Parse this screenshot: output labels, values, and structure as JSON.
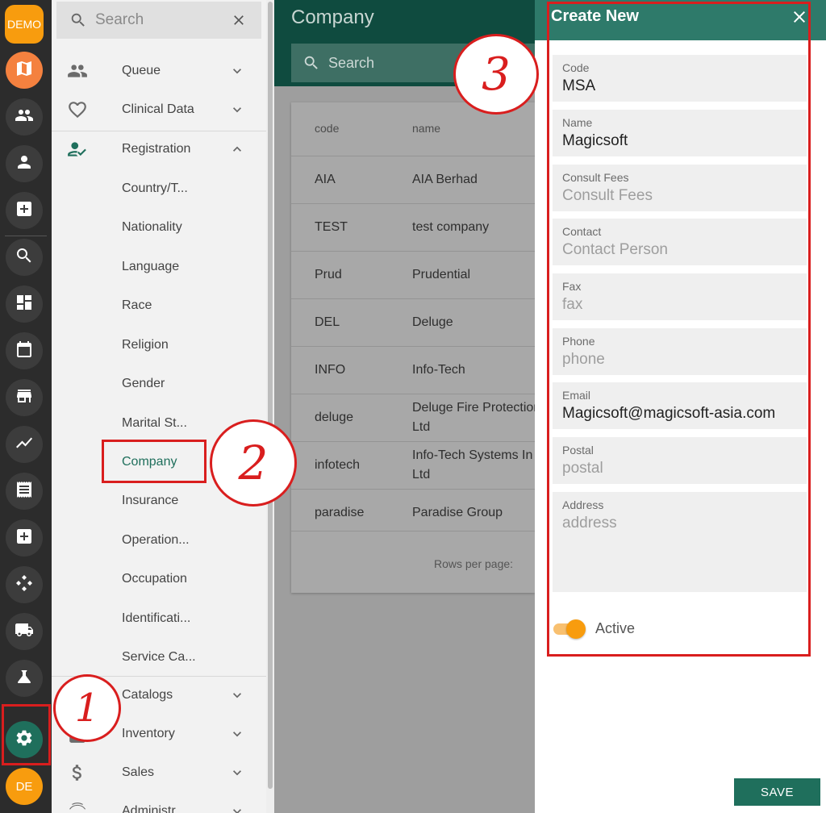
{
  "rail": {
    "demo_label": "DEMO",
    "avatar_label": "DE",
    "items": [
      {
        "icon": "map-icon"
      },
      {
        "icon": "people-icon"
      },
      {
        "icon": "person-icon"
      },
      {
        "icon": "medical-plus-icon"
      },
      {
        "icon": "search-icon"
      },
      {
        "icon": "dashboard-icon"
      },
      {
        "icon": "calendar-icon"
      },
      {
        "icon": "store-icon"
      },
      {
        "icon": "trending-icon"
      },
      {
        "icon": "receipt-icon"
      },
      {
        "icon": "medical-plus-icon"
      },
      {
        "icon": "hub-icon"
      },
      {
        "icon": "truck-icon"
      },
      {
        "icon": "flask-icon"
      },
      {
        "icon": "gear-icon"
      }
    ]
  },
  "nav": {
    "search_placeholder": "Search",
    "sections": [
      {
        "label": "Queue",
        "icon": "people-icon",
        "expanded": false
      },
      {
        "label": "Clinical Data",
        "icon": "heart-icon",
        "expanded": false
      },
      {
        "label": "Registration",
        "icon": "person-check-icon",
        "expanded": true
      }
    ],
    "registration_items": [
      "Country/T...",
      "Nationality",
      "Language",
      "Race",
      "Religion",
      "Gender",
      "Marital St...",
      "Company",
      "Insurance",
      "Operation...",
      "Occupation",
      "Identificati...",
      "Service Ca..."
    ],
    "lower_sections": [
      {
        "label": "Catalogs",
        "icon": "book-icon"
      },
      {
        "label": "Inventory",
        "icon": "box-icon"
      },
      {
        "label": "Sales",
        "icon": "dollar-icon"
      },
      {
        "label": "Administr...",
        "icon": "fingerprint-icon"
      }
    ],
    "active_item": "Company"
  },
  "main": {
    "title": "Company",
    "search_placeholder": "Search",
    "table": {
      "columns": [
        "code",
        "name"
      ],
      "rows": [
        {
          "code": "AIA",
          "name": "AIA Berhad"
        },
        {
          "code": "TEST",
          "name": "test company"
        },
        {
          "code": "Prud",
          "name": "Prudential"
        },
        {
          "code": "DEL",
          "name": "Deluge"
        },
        {
          "code": "INFO",
          "name": "Info-Tech"
        },
        {
          "code": "deluge",
          "name": "Deluge Fire Protection Ltd"
        },
        {
          "code": "infotech",
          "name": "Info-Tech Systems In Ltd"
        },
        {
          "code": "paradise",
          "name": "Paradise Group"
        }
      ],
      "footer": "Rows per page:"
    }
  },
  "drawer": {
    "title": "Create New",
    "fields": [
      {
        "label": "Code",
        "value": "MSA",
        "placeholder": ""
      },
      {
        "label": "Name",
        "value": "Magicsoft",
        "placeholder": ""
      },
      {
        "label": "Consult Fees",
        "value": "",
        "placeholder": "Consult Fees"
      },
      {
        "label": "Contact",
        "value": "",
        "placeholder": "Contact Person"
      },
      {
        "label": "Fax",
        "value": "",
        "placeholder": "fax"
      },
      {
        "label": "Phone",
        "value": "",
        "placeholder": "phone"
      },
      {
        "label": "Email",
        "value": "Magicsoft@magicsoft-asia.com",
        "placeholder": ""
      },
      {
        "label": "Postal",
        "value": "",
        "placeholder": "postal"
      },
      {
        "label": "Address",
        "value": "",
        "placeholder": "address"
      }
    ],
    "active_label": "Active",
    "active_on": true,
    "save_label": "SAVE"
  },
  "annotations": {
    "step1": "1",
    "step2": "2",
    "step3": "3"
  },
  "colors": {
    "accent": "#1f6f5c",
    "header_dark": "#0f4b3f",
    "drawer_header": "#2e7a6a",
    "orange": "#f89c0e",
    "annotation_red": "#d91e1e"
  }
}
